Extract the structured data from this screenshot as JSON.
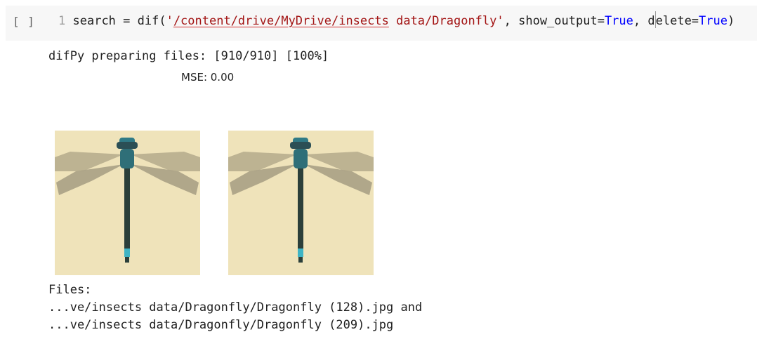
{
  "cell": {
    "run_indicator": "[ ]",
    "line_number": "1",
    "code": {
      "prefix": "search = dif(",
      "quote_open": "'",
      "path_underlined": "/content/drive/MyDrive/insects",
      "path_rest": " data/Dragonfly",
      "quote_close": "'",
      "arg1": ", show_output=",
      "arg1_value": "True",
      "arg2_sep": ", ",
      "arg2_d": "d",
      "arg2_rest": "elete=",
      "arg2_value": "True",
      "suffix": ")"
    }
  },
  "output": {
    "progress": "difPy preparing files: [910/910] [100%]",
    "mse_label": "MSE: 0.00",
    "images": [
      {
        "name": "dragonfly-image-1"
      },
      {
        "name": "dragonfly-image-2"
      }
    ],
    "files_label": "Files:",
    "file_1": "...ve/insects data/Dragonfly/Dragonfly (128).jpg and",
    "file_2": "...ve/insects data/Dragonfly/Dragonfly (209).jpg"
  },
  "colors": {
    "cell_bg": "#f7f7f7",
    "string": "#a31515",
    "keyword": "#0000ff",
    "thumbnail_bg": "#efe3ba",
    "dragonfly_body": "#2b3f3a",
    "dragonfly_head": "#2f7a86",
    "dragonfly_tail_tip": "#3fb4c4"
  }
}
